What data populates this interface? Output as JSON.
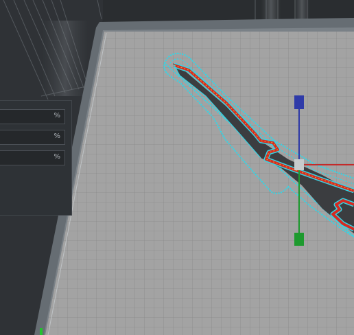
{
  "settings_panel": {
    "fields": [
      {
        "unit": "%"
      },
      {
        "unit": "%"
      },
      {
        "unit": "%"
      }
    ]
  },
  "colors": {
    "background": "#2a2d30",
    "build_plate": "#a3a3a3",
    "grid_line": "#8c8c8c",
    "plate_border": "#6f777f",
    "layer_red": "#d42a22",
    "layer_cyan": "#33d6e6",
    "model_dark": "#3b3d40",
    "axis_x": "#c42a2a",
    "axis_y": "#2e3aa8",
    "axis_z": "#1d9a2e"
  },
  "icons": [
    "move-gizmo-icon",
    "axis-handle-blue",
    "axis-handle-green",
    "axis-handle-center"
  ]
}
